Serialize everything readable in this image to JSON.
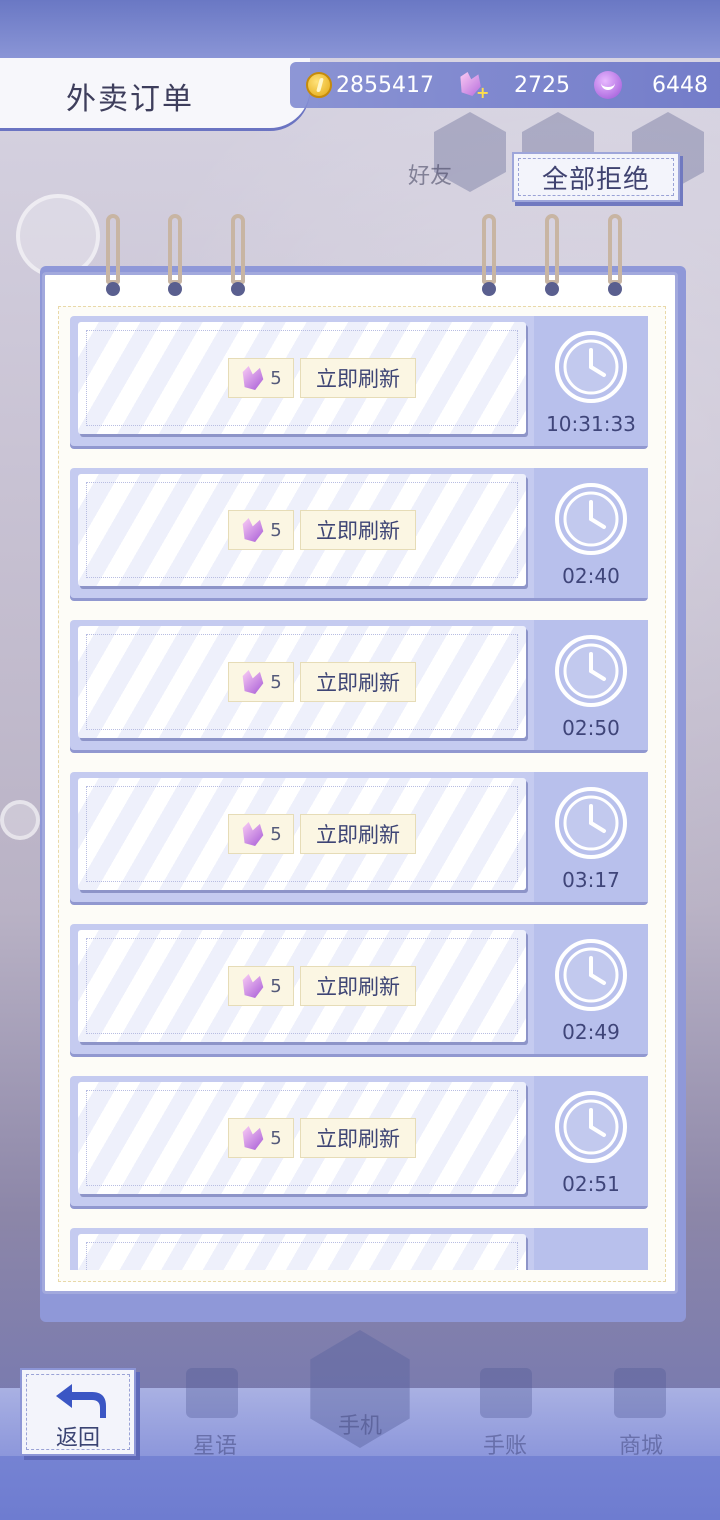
{
  "header": {
    "title": "外卖订单",
    "resources": {
      "coins": "2855417",
      "swans": "2725",
      "smiles": "6448"
    }
  },
  "background_labels": {
    "friend": "好友"
  },
  "actions": {
    "reject_all_label": "全部拒绝"
  },
  "orders": [
    {
      "cost": "5",
      "refresh_label": "立即刷新",
      "timer": "10:31:33"
    },
    {
      "cost": "5",
      "refresh_label": "立即刷新",
      "timer": "02:40"
    },
    {
      "cost": "5",
      "refresh_label": "立即刷新",
      "timer": "02:50"
    },
    {
      "cost": "5",
      "refresh_label": "立即刷新",
      "timer": "03:17"
    },
    {
      "cost": "5",
      "refresh_label": "立即刷新",
      "timer": "02:49"
    },
    {
      "cost": "5",
      "refresh_label": "立即刷新",
      "timer": "02:51"
    }
  ],
  "bottom_nav": {
    "back_label": "返回",
    "items": [
      "星语",
      "手机",
      "手账",
      "商城"
    ]
  },
  "icons": {
    "coin": "coin-icon",
    "swan": "swan-icon",
    "smile": "smile-icon",
    "clock": "clock-icon",
    "back": "back-arrow-icon"
  },
  "colors": {
    "accent": "#8f98d8",
    "panel": "#c5cbf0",
    "text_dark": "#3e4575"
  }
}
